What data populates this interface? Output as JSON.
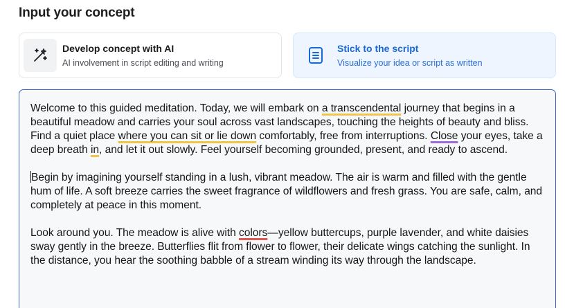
{
  "page": {
    "title": "Input your concept"
  },
  "options": [
    {
      "title": "Develop concept with AI",
      "subtitle": "AI involvement in script editing and writing",
      "icon": "magic-wand-icon",
      "selected": false
    },
    {
      "title": "Stick to the script",
      "subtitle": "Visualize your idea or script as written",
      "icon": "document-icon",
      "selected": true
    }
  ],
  "editor": {
    "p1": {
      "s1": "Welcome to this guided meditation. Today, we will embark on ",
      "u1": "a transcendental",
      "s2": " journey that begins in a beautiful meadow and carries your soul across vast landscapes, touching the heights of beauty and bliss. Find a quiet place ",
      "u2": "where you can sit or lie down",
      "s3": " comfortably, free from interruptions. ",
      "u3": "Close",
      "s4": " your eyes, take a deep breath ",
      "u4": "in",
      "s5": ", and let it out slowly. Feel yourself becoming grounded, present, and ready to ascend."
    },
    "p2": {
      "s1": "Begin by imagining yourself standing in a lush, vibrant meadow. The air is warm and filled with the gentle hum of life. A soft breeze carries the sweet fragrance of wildflowers and fresh grass. You are safe, calm, and completely at peace in this moment."
    },
    "p3": {
      "s1": "Look around you. The meadow is alive with ",
      "u1": "colors",
      "s2": "—yellow buttercups, purple lavender, and white daisies sway gently in the breeze. Butterflies flit from flower to flower, their delicate wings catching the sunlight. In the distance, you hear the soothing babble of a stream winding its way through the landscape."
    }
  },
  "colors": {
    "accent": "#1a67d6",
    "selected_bg": "#eef5ff",
    "editor_border": "#3a66c8",
    "grammar_underline": "#f0c64a",
    "style_underline": "#a06ad9",
    "spelling_underline": "#e0584f"
  }
}
